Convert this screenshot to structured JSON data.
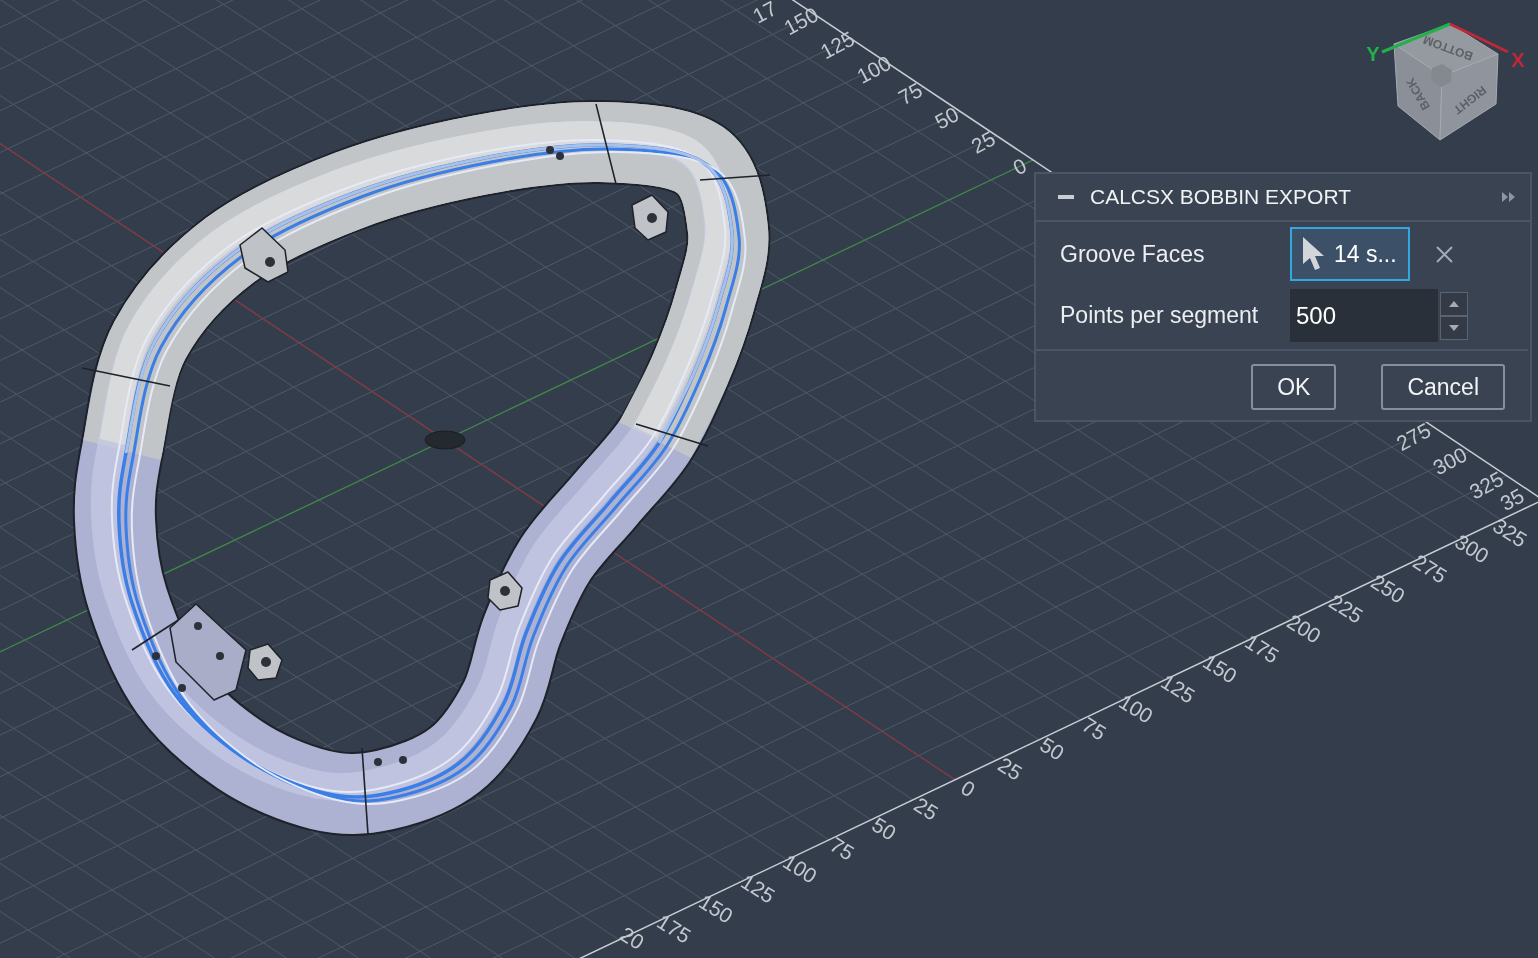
{
  "viewport": {
    "top_edge_labels": [
      "17",
      "150",
      "125",
      "100",
      "75",
      "50",
      "25",
      "0"
    ],
    "right_edge_labels": [
      "275",
      "300",
      "325",
      "35"
    ],
    "bottom_edge_labels": [
      "325",
      "300",
      "275",
      "250",
      "225",
      "200",
      "175",
      "150",
      "125",
      "100",
      "75",
      "50",
      "25",
      "0",
      "25",
      "50",
      "75",
      "100",
      "125",
      "150",
      "175",
      "20"
    ]
  },
  "view_cube": {
    "faces": [
      "BOTTOM",
      "BACK",
      "RIGHT"
    ],
    "axes": [
      "Y",
      "X"
    ]
  },
  "dialog": {
    "title": "CALCSX BOBBIN EXPORT",
    "fields": [
      {
        "kind": "selection",
        "label": "Groove Faces",
        "value": "14 s...",
        "active": true
      },
      {
        "kind": "number",
        "label": "Points per segment",
        "value": "500"
      }
    ],
    "buttons": [
      "OK",
      "Cancel"
    ]
  }
}
